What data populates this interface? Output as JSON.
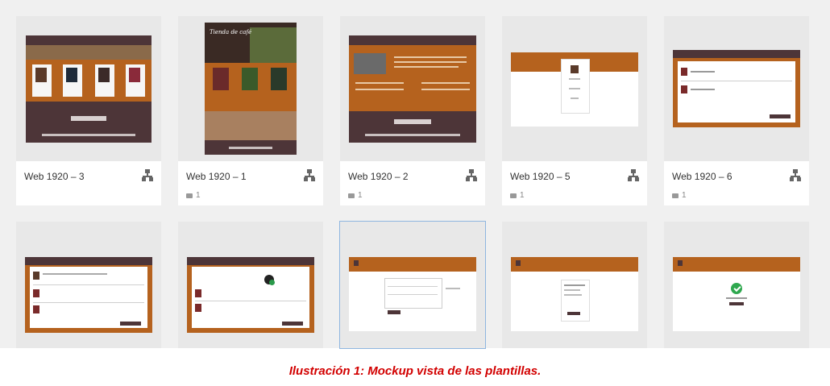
{
  "cards": [
    {
      "name": "Web 1920 – 3",
      "comments": ""
    },
    {
      "name": "Web 1920 – 1",
      "comments": "1"
    },
    {
      "name": "Web 1920 – 2",
      "comments": "1"
    },
    {
      "name": "Web 1920 – 5",
      "comments": "1"
    },
    {
      "name": "Web 1920 – 6",
      "comments": "1"
    }
  ],
  "thumb_texts": {
    "tienda_title": "Tienda de café"
  },
  "caption": "Ilustración 1: Mockup vista de las plantillas.",
  "colors": {
    "brown": "#b5621e",
    "dark": "#4d3538",
    "caption": "#d20000",
    "selection": "#8fb6e0"
  },
  "icons": [
    "comment-icon",
    "prototype-flow-icon",
    "check-icon"
  ]
}
